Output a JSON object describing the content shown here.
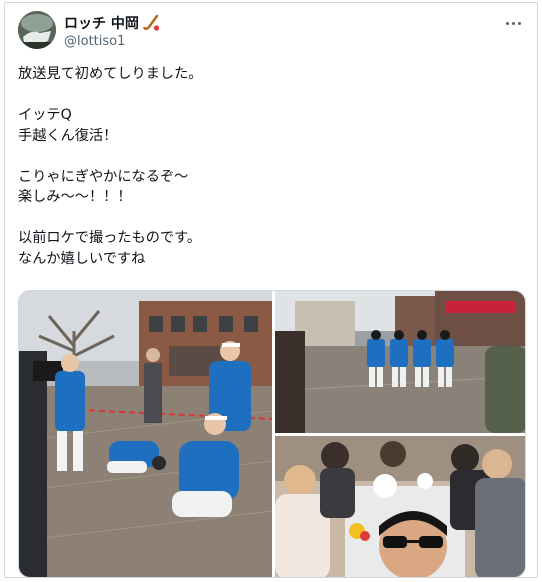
{
  "user": {
    "display_name": "ロッチ 中岡",
    "name_emoji": "hockey-stick-icon",
    "handle": "@lottiso1",
    "avatar_icon": "avatar"
  },
  "menu": {
    "more_icon": "more-options-icon"
  },
  "tweet": {
    "text": "放送見て初めてしりました。\n\nイッテQ\n手越くん復活！\n\nこりゃにぎやかになるぞ〜\n楽しみ〜〜！！！\n\n以前ロケで撮ったものです。\nなんか嬉しいですね"
  },
  "media": {
    "photos": [
      {
        "name": "photo-street-performers-kneeling"
      },
      {
        "name": "photo-marching-group"
      },
      {
        "name": "photo-group-selfie"
      }
    ]
  },
  "colors": {
    "text_primary": "#0f1419",
    "text_secondary": "#536471",
    "border": "#cfd9de",
    "costume_blue": "#1f6fc0"
  }
}
